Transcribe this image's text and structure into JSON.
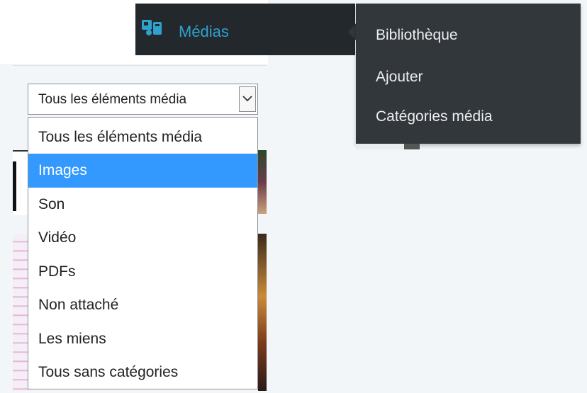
{
  "admin_menu": {
    "label": "Médias",
    "icon": "media-icon",
    "accent": "#2ea2cc",
    "submenu": [
      "Bibliothèque",
      "Ajouter",
      "Catégories média"
    ]
  },
  "filter": {
    "selected_value": "Tous les éléments média",
    "options": [
      "Tous les éléments média",
      "Images",
      "Son",
      "Vidéo",
      "PDFs",
      "Non attaché",
      "Les miens",
      "Tous sans catégories"
    ],
    "highlighted_option": "Images"
  }
}
